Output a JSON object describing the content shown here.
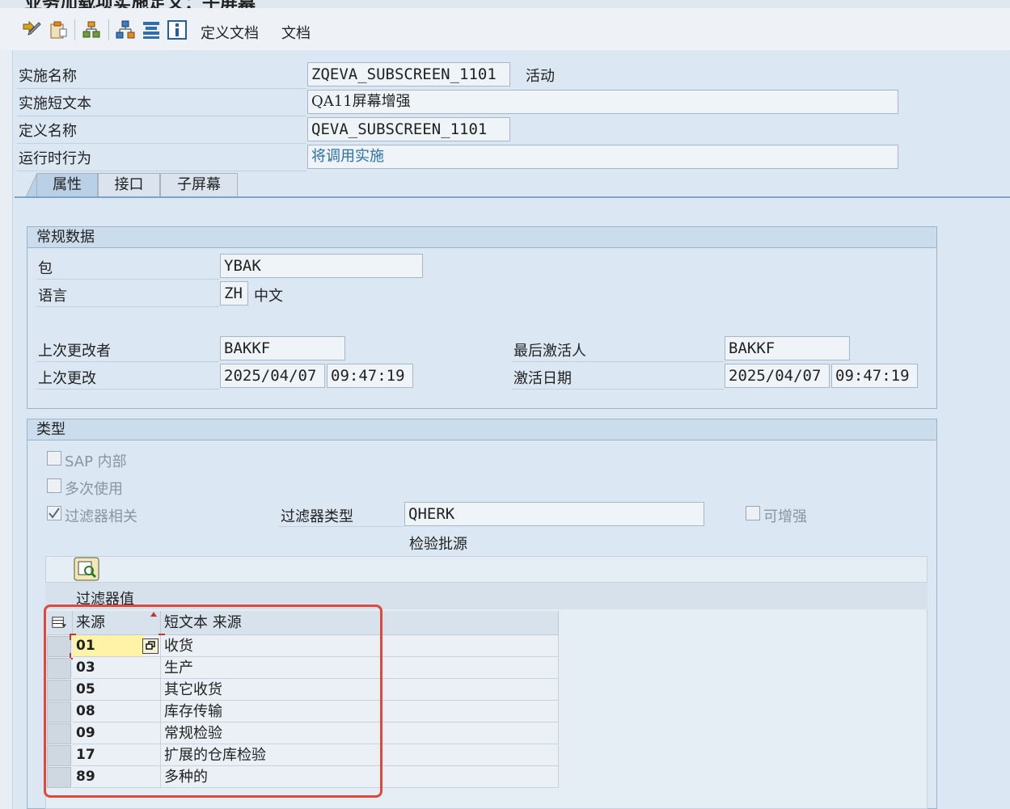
{
  "window": {
    "title": "业务加载项实施定义：子屏幕"
  },
  "toolbar": {
    "define_doc": "定义文档",
    "doc": "文档"
  },
  "header": {
    "impl_name_label": "实施名称",
    "impl_name_value": "ZQEVA_SUBSCREEN_1101",
    "status": "活动",
    "impl_short_text_label": "实施短文本",
    "impl_short_text_value": "QA11屏幕增强",
    "def_name_label": "定义名称",
    "def_name_value": "QEVA_SUBSCREEN_1101",
    "runtime_label": "运行时行为",
    "runtime_value": "将调用实施"
  },
  "tabs": [
    {
      "label": "属性"
    },
    {
      "label": "接口"
    },
    {
      "label": "子屏幕"
    }
  ],
  "general": {
    "title": "常规数据",
    "package_label": "包",
    "package_value": "YBAK",
    "language_label": "语言",
    "language_code": "ZH",
    "language_name": "中文",
    "last_changed_by_label": "上次更改者",
    "last_changed_by_value": "BAKKF",
    "last_changed_label": "上次更改",
    "last_changed_date": "2025/04/07",
    "last_changed_time": "09:47:19",
    "last_activated_by_label": "最后激活人",
    "last_activated_by_value": "BAKKF",
    "activation_date_label": "激活日期",
    "activation_date": "2025/04/07",
    "activation_time": "09:47:19"
  },
  "type": {
    "title": "类型",
    "sap_internal": "SAP 内部",
    "multiple_use": "多次使用",
    "filter_dependent": "过滤器相关",
    "filter_type_label": "过滤器类型",
    "filter_type_value": "QHERK",
    "filter_type_desc": "检验批源",
    "can_enhance": "可增强",
    "filter_values_label": "过滤器值"
  },
  "table": {
    "columns": [
      "来源",
      "短文本 来源"
    ],
    "rows": [
      {
        "code": "01",
        "text": "收货"
      },
      {
        "code": "03",
        "text": "生产"
      },
      {
        "code": "05",
        "text": "其它收货"
      },
      {
        "code": "08",
        "text": "库存传输"
      },
      {
        "code": "09",
        "text": "常规检验"
      },
      {
        "code": "17",
        "text": "扩展的仓库检验"
      },
      {
        "code": "89",
        "text": "多种的"
      }
    ]
  },
  "colors": {
    "accent": "#2a6fa8",
    "highlight": "#e0483d",
    "focus_cell": "#fff3a8"
  }
}
